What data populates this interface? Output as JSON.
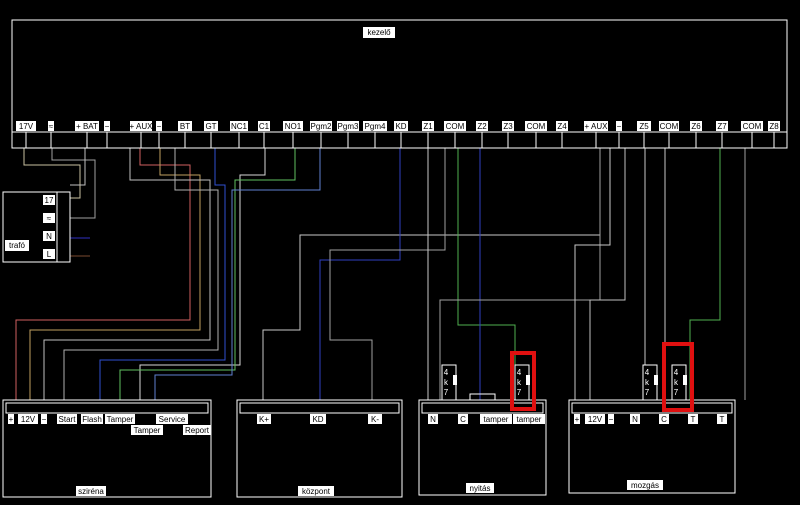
{
  "panel": {
    "title": "kezelő",
    "terminals": [
      "17V",
      "≈",
      "+ BAT",
      "−",
      "+ AUX",
      "−",
      "BT",
      "GT",
      "NC1",
      "C1",
      "NO1",
      "Pgm2",
      "Pgm3",
      "Pgm4",
      "KD",
      "Z1",
      "COM",
      "Z2",
      "Z3",
      "COM",
      "Z4",
      "+ AUX",
      "−",
      "Z5",
      "COM",
      "Z6",
      "Z7",
      "COM",
      "Z8"
    ]
  },
  "trafo": {
    "label": "trafó",
    "terminals": [
      "17",
      "≈",
      "N",
      "L"
    ]
  },
  "sziréna": {
    "label": "sziréna",
    "terminals": [
      "+",
      "12V",
      "−",
      "Start",
      "Flash",
      "Tamper",
      "Service",
      "Tamper",
      "Report"
    ]
  },
  "kozpont": {
    "label": "központ",
    "terminals": [
      "K+",
      "KD",
      "K-"
    ]
  },
  "nyitas": {
    "label": "nyitás",
    "terminals": [
      "N",
      "C",
      "tamper",
      "tamper"
    ],
    "resistors": [
      "4 k 7",
      "4 k 7"
    ]
  },
  "mozgas": {
    "label": "mozgás",
    "terminals": [
      "+",
      "12V",
      "−",
      "N",
      "C",
      "T",
      "T"
    ],
    "resistors": [
      "4 k 7",
      "4 k 7"
    ]
  },
  "colors": {
    "background": "#000000",
    "box": "#ffffff",
    "highlight": "#e01010"
  }
}
